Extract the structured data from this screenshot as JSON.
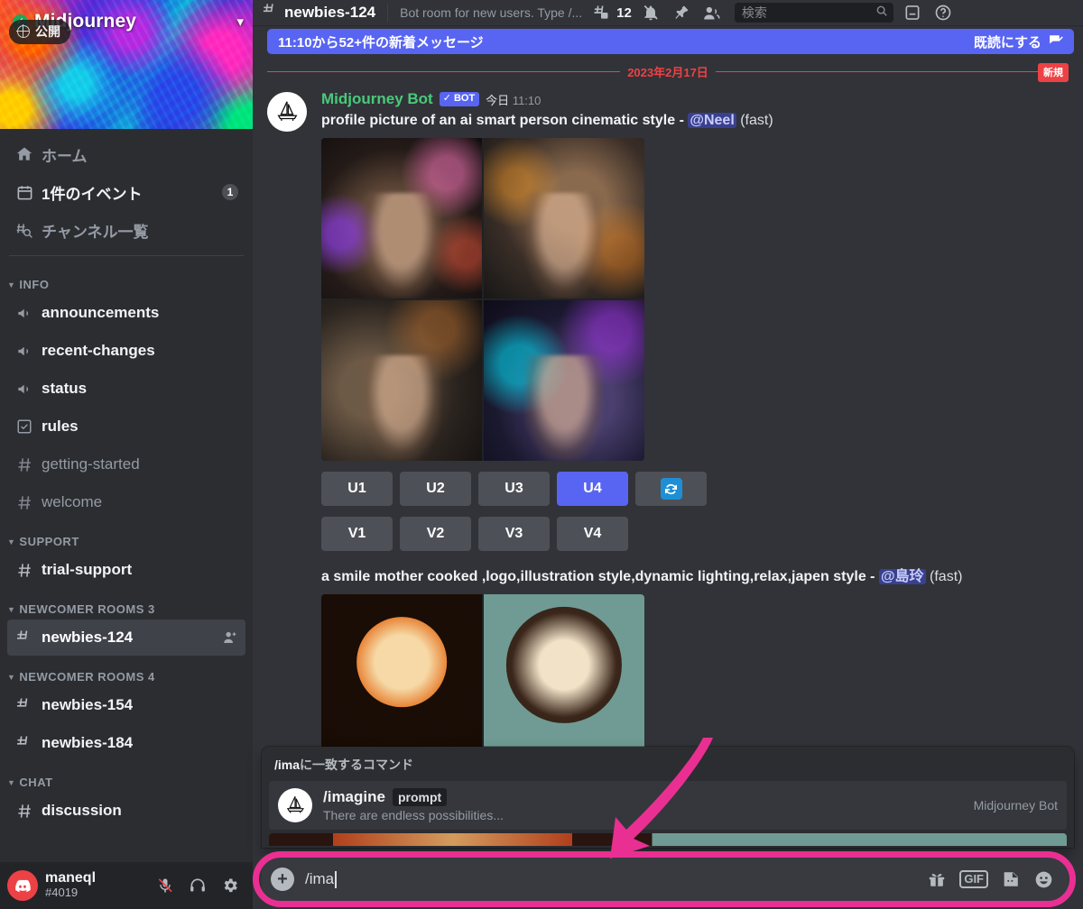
{
  "server": {
    "name": "Midjourney",
    "verified_icon": "verified-check-icon",
    "public_label": "公開",
    "chevron_icon": "chevron-down-icon"
  },
  "sidebar": {
    "nav": [
      {
        "label": "ホーム",
        "icon": "home-icon",
        "badge": null,
        "style": "muted"
      },
      {
        "label": "1件のイベント",
        "icon": "calendar-icon",
        "badge": "1",
        "style": "strong"
      },
      {
        "label": "チャンネル一覧",
        "icon": "browse-channels-icon",
        "badge": null,
        "style": "muted"
      }
    ],
    "categories": [
      {
        "name": "INFO",
        "channels": [
          {
            "name": "announcements",
            "icon": "announcement-icon",
            "state": "unread"
          },
          {
            "name": "recent-changes",
            "icon": "announcement-icon",
            "state": "unread"
          },
          {
            "name": "status",
            "icon": "announcement-icon",
            "state": "unread"
          },
          {
            "name": "rules",
            "icon": "rules-icon",
            "state": "unread"
          },
          {
            "name": "getting-started",
            "icon": "hash-icon",
            "state": "muted"
          },
          {
            "name": "welcome",
            "icon": "hash-icon",
            "state": "muted"
          }
        ]
      },
      {
        "name": "SUPPORT",
        "channels": [
          {
            "name": "trial-support",
            "icon": "hash-icon",
            "state": "unread"
          }
        ]
      },
      {
        "name": "NEWCOMER ROOMS 3",
        "channels": [
          {
            "name": "newbies-124",
            "icon": "hash-thread-lock-icon",
            "state": "active",
            "trailing_icon": "add-member-icon"
          }
        ]
      },
      {
        "name": "NEWCOMER ROOMS 4",
        "channels": [
          {
            "name": "newbies-154",
            "icon": "hash-thread-lock-icon",
            "state": "unread"
          },
          {
            "name": "newbies-184",
            "icon": "hash-thread-lock-icon",
            "state": "unread"
          }
        ]
      },
      {
        "name": "CHAT",
        "channels": [
          {
            "name": "discussion",
            "icon": "hash-icon",
            "state": "unread"
          }
        ]
      }
    ],
    "user": {
      "name": "maneql",
      "tag": "#4019",
      "avatar_icon": "discord-logo-icon",
      "actions": [
        {
          "name": "mic-muted-icon"
        },
        {
          "name": "headphones-icon"
        },
        {
          "name": "gear-icon"
        }
      ]
    }
  },
  "header": {
    "channel_icon": "hash-thread-lock-icon",
    "channel_name": "newbies-124",
    "topic": "Bot room for new users. Type /...",
    "threads_icon": "threads-icon",
    "threads_count": "12",
    "notifications_icon": "bell-off-icon",
    "pin_icon": "pin-icon",
    "members_icon": "members-icon",
    "search_placeholder": "検索",
    "search_icon": "search-icon",
    "inbox_icon": "inbox-icon",
    "help_icon": "help-icon"
  },
  "new_messages_bar": {
    "text": "11:10から52+件の新着メッセージ",
    "mark_read_label": "既読にする",
    "mark_read_icon": "mark-read-icon"
  },
  "date_divider": {
    "label": "2023年2月17日",
    "new_chip": "新規"
  },
  "messages": [
    {
      "author": "Midjourney Bot",
      "bot_tag": "BOT",
      "bot_check_icon": "check-icon",
      "timestamp_day": "今日",
      "timestamp_time": "11:10",
      "avatar_icon": "midjourney-sailboat-icon",
      "prompt": "profile picture of an ai smart person cinematic style",
      "separator": "-",
      "mention": "@Neel",
      "suffix": "(fast)",
      "buttons_row1": [
        {
          "label": "U1",
          "style": "secondary"
        },
        {
          "label": "U2",
          "style": "secondary"
        },
        {
          "label": "U3",
          "style": "secondary"
        },
        {
          "label": "U4",
          "style": "primary"
        },
        {
          "label": "",
          "style": "reroll",
          "icon": "reroll-icon"
        }
      ],
      "buttons_row2": [
        {
          "label": "V1",
          "style": "secondary"
        },
        {
          "label": "V2",
          "style": "secondary"
        },
        {
          "label": "V3",
          "style": "secondary"
        },
        {
          "label": "V4",
          "style": "secondary"
        }
      ]
    },
    {
      "prompt": "a smile mother cooked ,logo,illustration style,dynamic lighting,relax,japen style",
      "separator": "-",
      "mention": "@島玲",
      "suffix": "(fast)"
    }
  ],
  "command_popup": {
    "header_prefix": "/ima",
    "header_suffix": "に一致するコマンド",
    "item": {
      "avatar_icon": "midjourney-sailboat-icon",
      "name": "/imagine",
      "arg": "prompt",
      "description": "There are endless possibilities...",
      "owner": "Midjourney Bot"
    }
  },
  "composer": {
    "plus_icon": "add-attachment-icon",
    "value": "/ima",
    "gift_icon": "gift-icon",
    "gif_label": "GIF",
    "sticker_icon": "sticker-icon",
    "emoji_icon": "emoji-icon"
  },
  "annotation": {
    "arrow_color": "#ea2f92",
    "highlight_color": "#ea2f92"
  },
  "colors": {
    "accent": "#5865f2",
    "sidebar_bg": "#2b2d31",
    "main_bg": "#313338",
    "danger": "#ed4245",
    "bot_green": "#49ca7a"
  }
}
